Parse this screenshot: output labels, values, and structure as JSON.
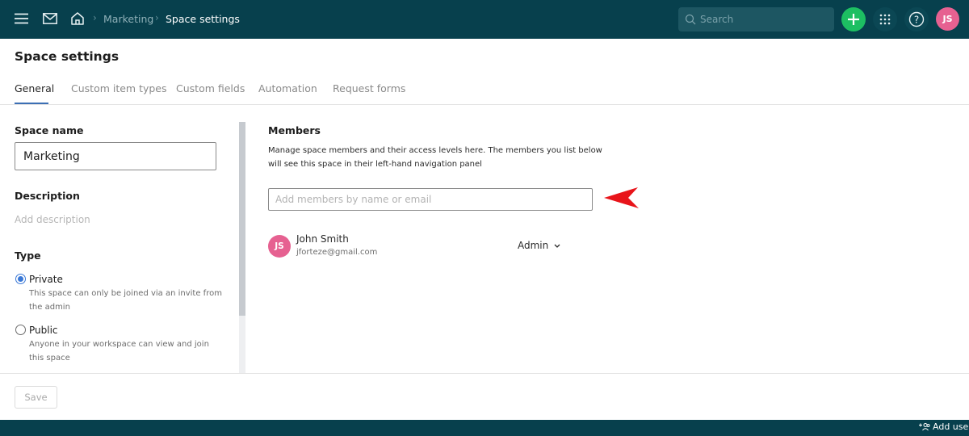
{
  "topbar": {
    "icons": [
      "menu-icon",
      "mail-icon",
      "home-icon"
    ],
    "breadcrumb": [
      {
        "label": "Marketing",
        "current": false
      },
      {
        "label": "Space settings",
        "current": true
      }
    ],
    "search": {
      "placeholder": "Search"
    },
    "user_initials": "JS",
    "colors": {
      "bar": "#07404d",
      "add": "#1dbf62",
      "avatar": "#e66191"
    }
  },
  "page": {
    "title": "Space settings",
    "tabs": [
      {
        "label": "General",
        "active": true
      },
      {
        "label": "Custom item types",
        "active": false
      },
      {
        "label": "Custom fields",
        "active": false
      },
      {
        "label": "Automation",
        "active": false
      },
      {
        "label": "Request forms",
        "active": false
      }
    ]
  },
  "general": {
    "space_name_label": "Space name",
    "space_name_value": "Marketing",
    "description_label": "Description",
    "description_placeholder": "Add description",
    "type_label": "Type",
    "types": [
      {
        "label": "Private",
        "desc": "This space can only be joined via an invite from the admin",
        "selected": true
      },
      {
        "label": "Public",
        "desc": "Anyone in your workspace can view and join this space",
        "selected": false
      }
    ]
  },
  "members": {
    "title": "Members",
    "description": "Manage space members and their access levels here. The members you list below will see this space in their left-hand navigation panel",
    "input_placeholder": "Add members by name or email",
    "list": [
      {
        "initials": "JS",
        "name": "John Smith",
        "email": "jforteze@gmail.com",
        "role": "Admin"
      }
    ]
  },
  "footer": {
    "save_label": "Save",
    "add_users_label": "Add users"
  },
  "annotation": {
    "type": "red-arrow",
    "color": "#e8141a",
    "points_to": "members-input"
  }
}
